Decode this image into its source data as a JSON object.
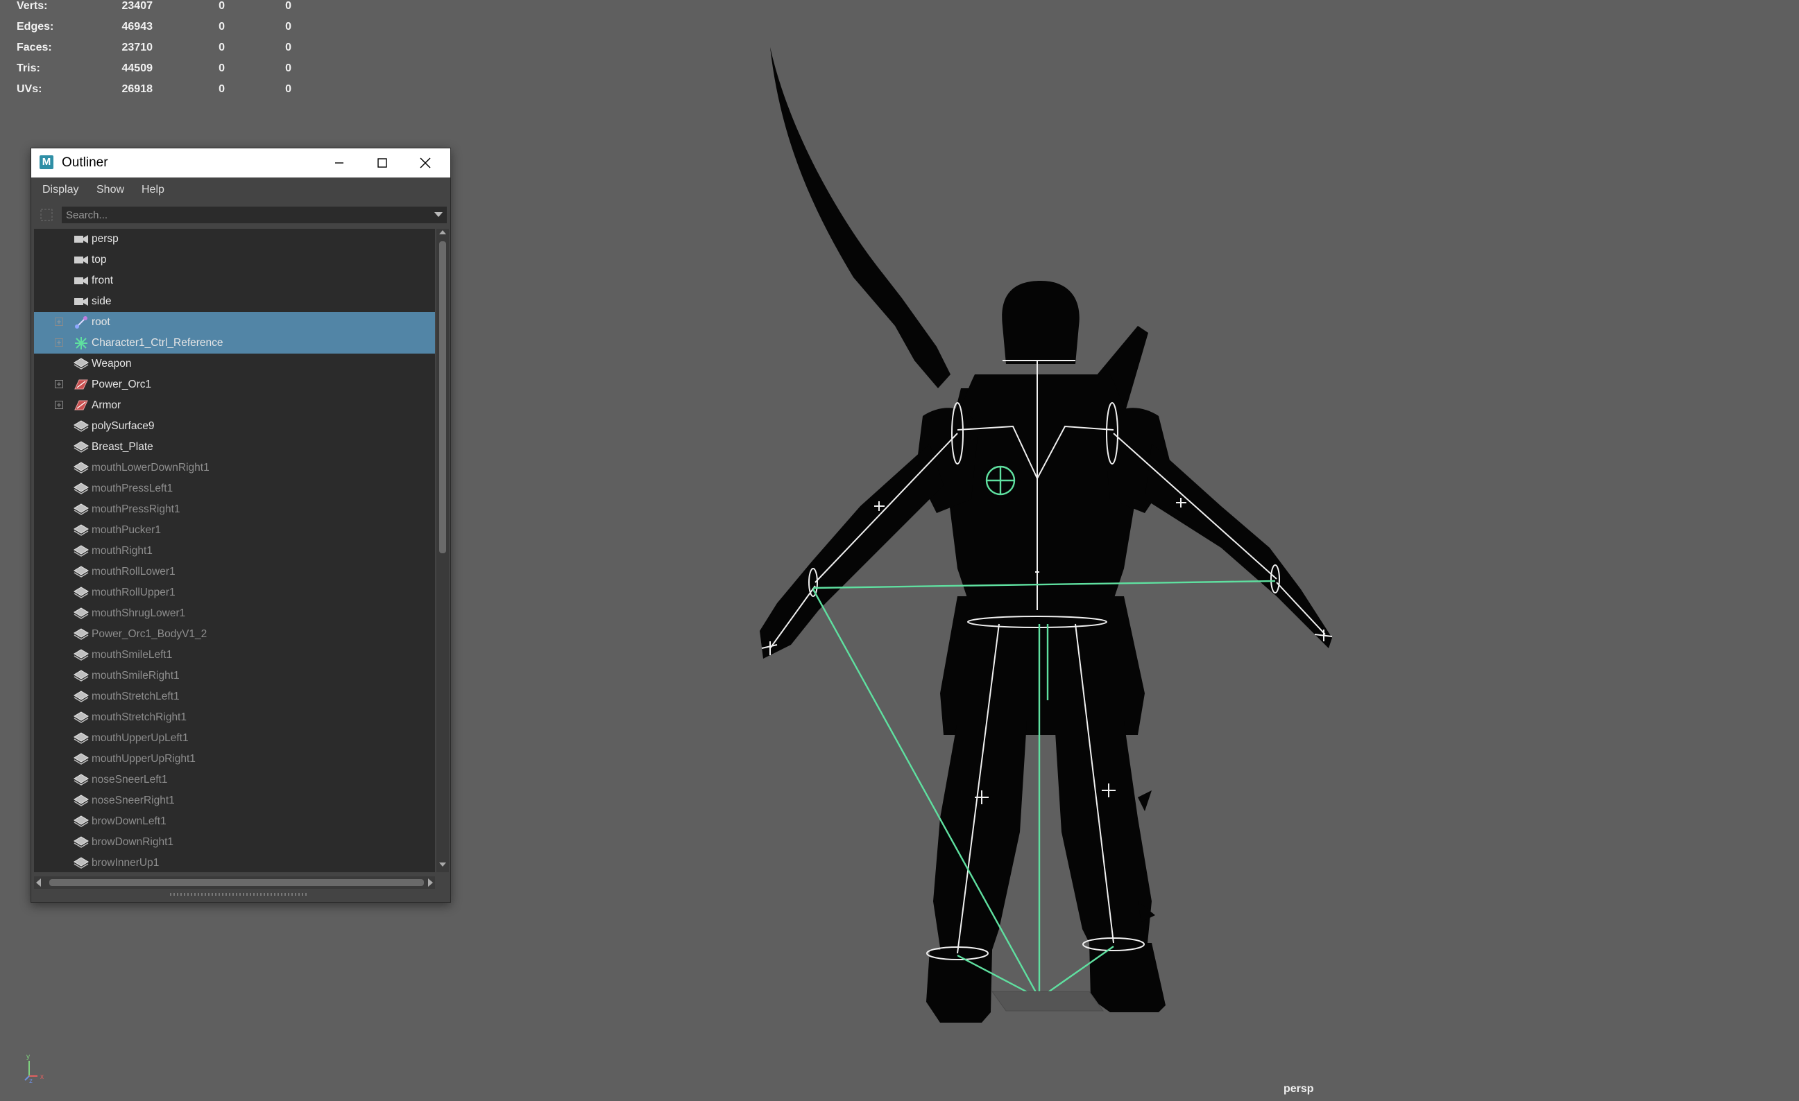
{
  "hud": {
    "rows": [
      {
        "label": "Verts:",
        "value": "23407",
        "a": "0",
        "b": "0"
      },
      {
        "label": "Edges:",
        "value": "46943",
        "a": "0",
        "b": "0"
      },
      {
        "label": "Faces:",
        "value": "23710",
        "a": "0",
        "b": "0"
      },
      {
        "label": "Tris:",
        "value": "44509",
        "a": "0",
        "b": "0"
      },
      {
        "label": "UVs:",
        "value": "26918",
        "a": "0",
        "b": "0"
      }
    ]
  },
  "viewport": {
    "camera_label": "persp",
    "axis": {
      "y": "y",
      "z": "z",
      "x": "x"
    }
  },
  "outliner": {
    "title": "Outliner",
    "app_icon": "M",
    "menu": [
      "Display",
      "Show",
      "Help"
    ],
    "search_placeholder": "Search...",
    "items": [
      {
        "label": "persp",
        "icon": "camera-icon",
        "dim": false,
        "selected": false,
        "expandable": false
      },
      {
        "label": "top",
        "icon": "camera-icon",
        "dim": false,
        "selected": false,
        "expandable": false
      },
      {
        "label": "front",
        "icon": "camera-icon",
        "dim": false,
        "selected": false,
        "expandable": false
      },
      {
        "label": "side",
        "icon": "camera-icon",
        "dim": false,
        "selected": false,
        "expandable": false
      },
      {
        "label": "root",
        "icon": "joint-icon",
        "dim": false,
        "selected": true,
        "expandable": true
      },
      {
        "label": "Character1_Ctrl_Reference",
        "icon": "hik-reference-icon",
        "dim": false,
        "selected": true,
        "expandable": true
      },
      {
        "label": "Weapon",
        "icon": "mesh-icon",
        "dim": false,
        "selected": false,
        "expandable": false
      },
      {
        "label": "Power_Orc1",
        "icon": "group-icon",
        "dim": false,
        "selected": false,
        "expandable": true
      },
      {
        "label": "Armor",
        "icon": "group-icon",
        "dim": false,
        "selected": false,
        "expandable": true
      },
      {
        "label": "polySurface9",
        "icon": "mesh-icon",
        "dim": false,
        "selected": false,
        "expandable": false
      },
      {
        "label": "Breast_Plate",
        "icon": "mesh-icon",
        "dim": false,
        "selected": false,
        "expandable": false
      },
      {
        "label": "mouthLowerDownRight1",
        "icon": "mesh-icon",
        "dim": true,
        "selected": false,
        "expandable": false
      },
      {
        "label": "mouthPressLeft1",
        "icon": "mesh-icon",
        "dim": true,
        "selected": false,
        "expandable": false
      },
      {
        "label": "mouthPressRight1",
        "icon": "mesh-icon",
        "dim": true,
        "selected": false,
        "expandable": false
      },
      {
        "label": "mouthPucker1",
        "icon": "mesh-icon",
        "dim": true,
        "selected": false,
        "expandable": false
      },
      {
        "label": "mouthRight1",
        "icon": "mesh-icon",
        "dim": true,
        "selected": false,
        "expandable": false
      },
      {
        "label": "mouthRollLower1",
        "icon": "mesh-icon",
        "dim": true,
        "selected": false,
        "expandable": false
      },
      {
        "label": "mouthRollUpper1",
        "icon": "mesh-icon",
        "dim": true,
        "selected": false,
        "expandable": false
      },
      {
        "label": "mouthShrugLower1",
        "icon": "mesh-icon",
        "dim": true,
        "selected": false,
        "expandable": false
      },
      {
        "label": "Power_Orc1_BodyV1_2",
        "icon": "mesh-icon",
        "dim": true,
        "selected": false,
        "expandable": false
      },
      {
        "label": "mouthSmileLeft1",
        "icon": "mesh-icon",
        "dim": true,
        "selected": false,
        "expandable": false
      },
      {
        "label": "mouthSmileRight1",
        "icon": "mesh-icon",
        "dim": true,
        "selected": false,
        "expandable": false
      },
      {
        "label": "mouthStretchLeft1",
        "icon": "mesh-icon",
        "dim": true,
        "selected": false,
        "expandable": false
      },
      {
        "label": "mouthStretchRight1",
        "icon": "mesh-icon",
        "dim": true,
        "selected": false,
        "expandable": false
      },
      {
        "label": "mouthUpperUpLeft1",
        "icon": "mesh-icon",
        "dim": true,
        "selected": false,
        "expandable": false
      },
      {
        "label": "mouthUpperUpRight1",
        "icon": "mesh-icon",
        "dim": true,
        "selected": false,
        "expandable": false
      },
      {
        "label": "noseSneerLeft1",
        "icon": "mesh-icon",
        "dim": true,
        "selected": false,
        "expandable": false
      },
      {
        "label": "noseSneerRight1",
        "icon": "mesh-icon",
        "dim": true,
        "selected": false,
        "expandable": false
      },
      {
        "label": "browDownLeft1",
        "icon": "mesh-icon",
        "dim": true,
        "selected": false,
        "expandable": false
      },
      {
        "label": "browDownRight1",
        "icon": "mesh-icon",
        "dim": true,
        "selected": false,
        "expandable": false
      },
      {
        "label": "browInnerUp1",
        "icon": "mesh-icon",
        "dim": true,
        "selected": false,
        "expandable": false
      }
    ]
  },
  "colors": {
    "viewport_bg": "#5f5f5f",
    "selection": "#5285a6",
    "skeleton": "#f0f0f0",
    "ik_lines": "#5fe0a0",
    "silhouette": "#050505"
  }
}
